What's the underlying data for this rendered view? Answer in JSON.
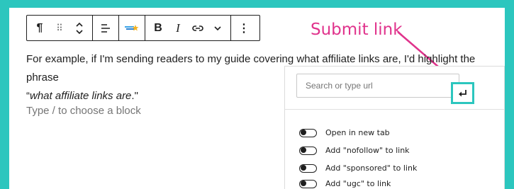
{
  "toolbar": {
    "paragraph_glyph": "¶",
    "drag_glyph": "⠿",
    "bold_label": "B",
    "italic_label": "I",
    "more_glyph": "⋮"
  },
  "annotation": {
    "text": "Submit link",
    "color": "#e0338c"
  },
  "content": {
    "paragraph_line1": "For example, if I'm sending readers to my guide covering what affiliate links are, I'd highlight the phrase",
    "quote_open": "“",
    "quote_emph": "what affiliate links are",
    "quote_close": ".\"",
    "placeholder": "Type / to choose a block"
  },
  "link_popover": {
    "search_placeholder": "Search or type url",
    "search_value": "",
    "submit_icon": "enter-icon",
    "options": [
      {
        "label": "Open in new tab",
        "enabled": false
      },
      {
        "label": "Add \"nofollow\" to link",
        "enabled": false
      },
      {
        "label": "Add \"sponsored\" to link",
        "enabled": false
      },
      {
        "label": "Add \"ugc\" to link",
        "enabled": false
      }
    ]
  },
  "colors": {
    "frame": "#2cc6be",
    "highlight": "#2cc6be",
    "annotation": "#e0338c"
  }
}
